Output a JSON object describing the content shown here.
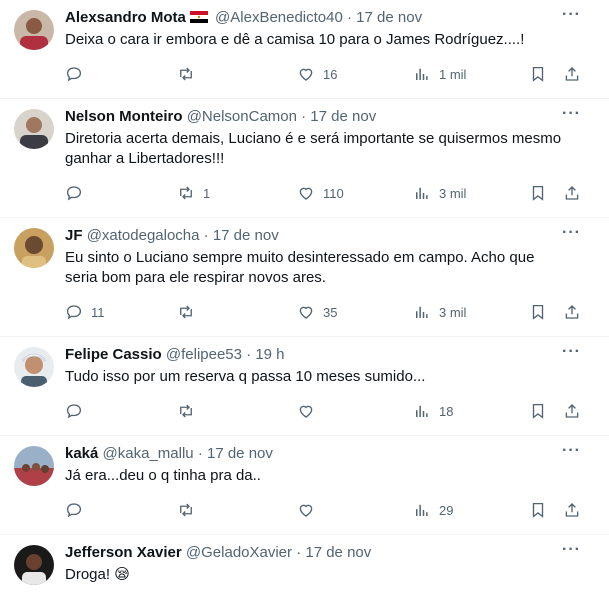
{
  "tweets": [
    {
      "name": "Alexsandro Mota",
      "handle": "@AlexBenedicto40",
      "date": "· 17 de nov",
      "text": "Deixa o cara ir embora e dê a camisa 10 para o James Rodríguez....!",
      "replies": "",
      "retweets": "",
      "likes": "16",
      "views": "1 mil",
      "flag": "egypt-flag-icon"
    },
    {
      "name": "Nelson Monteiro",
      "handle": "@NelsonCamon",
      "date": "· 17 de nov",
      "text": "Diretoria acerta demais, Luciano é e será importante se quisermos mesmo ganhar a Libertadores!!!",
      "replies": "",
      "retweets": "1",
      "likes": "110",
      "views": "3 mil"
    },
    {
      "name": "JF",
      "handle": "@xatodegalocha",
      "date": "· 17 de nov",
      "text": "Eu sinto o Luciano sempre muito desinteressado em campo. Acho que seria bom para ele respirar novos ares.",
      "replies": "11",
      "retweets": "",
      "likes": "35",
      "views": "3 mil"
    },
    {
      "name": "Felipe Cassio",
      "handle": "@felipee53",
      "date": "· 19 h",
      "text": "Tudo isso por um reserva q passa 10 meses sumido...",
      "replies": "",
      "retweets": "",
      "likes": "",
      "views": "18"
    },
    {
      "name": "kaká",
      "handle": "@kaka_mallu",
      "date": "· 17 de nov",
      "text": "Já era...deu o q tinha pra da..",
      "replies": "",
      "retweets": "",
      "likes": "",
      "views": "29"
    },
    {
      "name": "Jefferson Xavier",
      "handle": "@GeladoXavier",
      "date": "· 17 de nov",
      "text": "Droga! 😪",
      "replies": "",
      "retweets": "",
      "likes": "",
      "views": ""
    }
  ],
  "more_glyph": "···",
  "colors": {
    "text": "#0f1419",
    "muted": "#536471",
    "divider": "#eff3f4"
  }
}
